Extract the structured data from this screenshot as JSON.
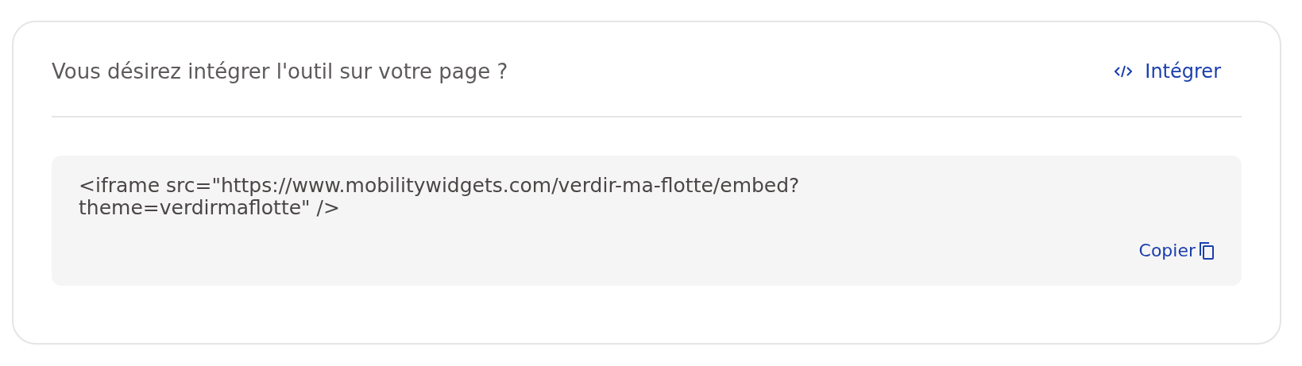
{
  "header": {
    "question": "Vous désirez intégrer l'outil sur votre page ?",
    "embed_button": "Intégrer"
  },
  "code_box": {
    "code": "<iframe src=\"https://www.mobilitywidgets.com/verdir-ma-flotte/embed?theme=verdirmaflotte\" />",
    "copy_button": "Copier"
  }
}
